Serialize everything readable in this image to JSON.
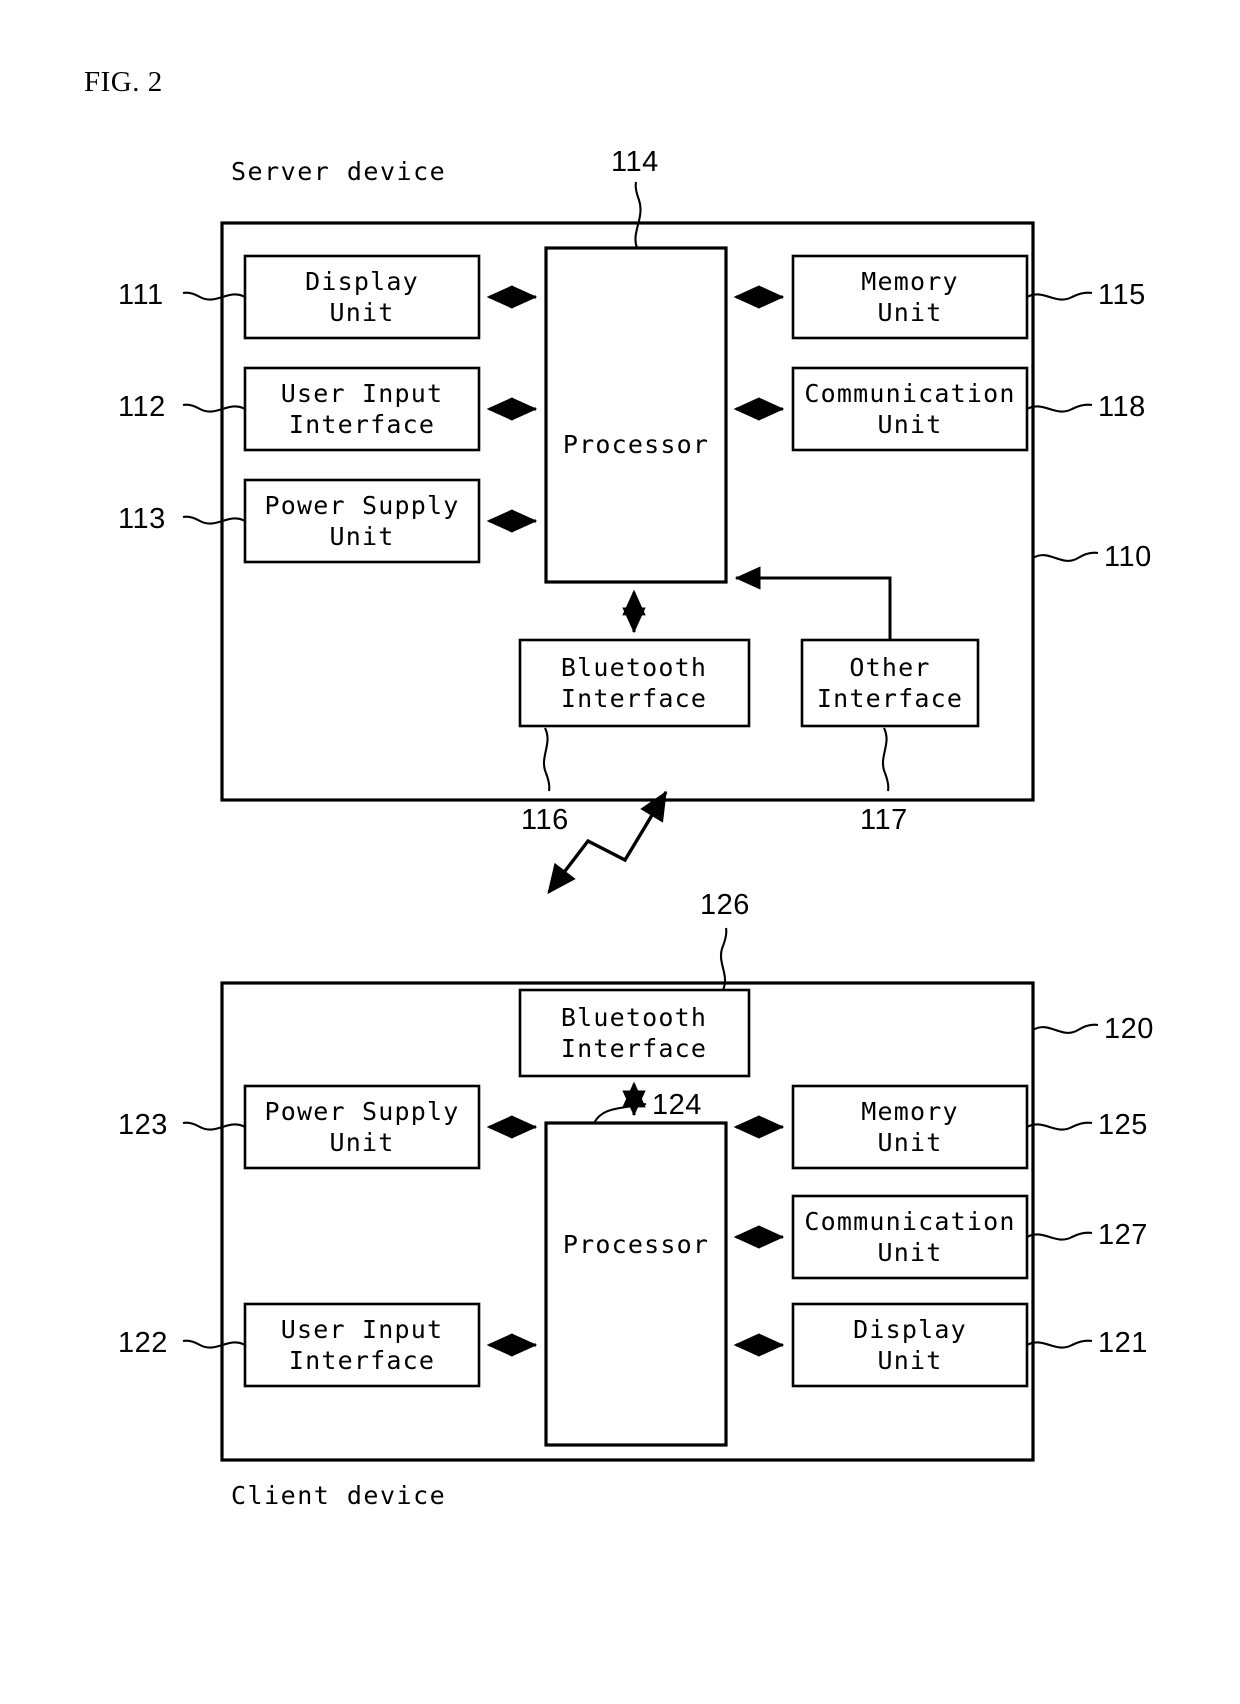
{
  "figure": {
    "title": "FIG. 2"
  },
  "server": {
    "caption": "Server device",
    "ref": "110",
    "processor": {
      "label": "Processor",
      "ref": "114"
    },
    "left_blocks": [
      {
        "label_line1": "Display",
        "label_line2": "Unit",
        "ref": "111"
      },
      {
        "label_line1": "User Input",
        "label_line2": "Interface",
        "ref": "112"
      },
      {
        "label_line1": "Power Supply",
        "label_line2": "Unit",
        "ref": "113"
      }
    ],
    "right_blocks": [
      {
        "label_line1": "Memory",
        "label_line2": "Unit",
        "ref": "115"
      },
      {
        "label_line1": "Communication",
        "label_line2": "Unit",
        "ref": "118"
      }
    ],
    "bottom_blocks": [
      {
        "label_line1": "Bluetooth",
        "label_line2": "Interface",
        "ref": "116"
      },
      {
        "label_line1": "Other",
        "label_line2": "Interface",
        "ref": "117"
      }
    ]
  },
  "client": {
    "caption": "Client device",
    "ref": "120",
    "processor": {
      "label": "Processor",
      "ref": "124"
    },
    "top_blocks": [
      {
        "label_line1": "Bluetooth",
        "label_line2": "Interface",
        "ref": "126"
      }
    ],
    "left_blocks": [
      {
        "label_line1": "Power Supply",
        "label_line2": "Unit",
        "ref": "123"
      },
      {
        "label_line1": "User Input",
        "label_line2": "Interface",
        "ref": "122"
      }
    ],
    "right_blocks": [
      {
        "label_line1": "Memory",
        "label_line2": "Unit",
        "ref": "125"
      },
      {
        "label_line1": "Communication",
        "label_line2": "Unit",
        "ref": "127"
      },
      {
        "label_line1": "Display",
        "label_line2": "Unit",
        "ref": "121"
      }
    ]
  },
  "link": {
    "name": "wireless-bluetooth-link"
  },
  "colors": {
    "ink": "#000000",
    "paper": "#ffffff"
  }
}
